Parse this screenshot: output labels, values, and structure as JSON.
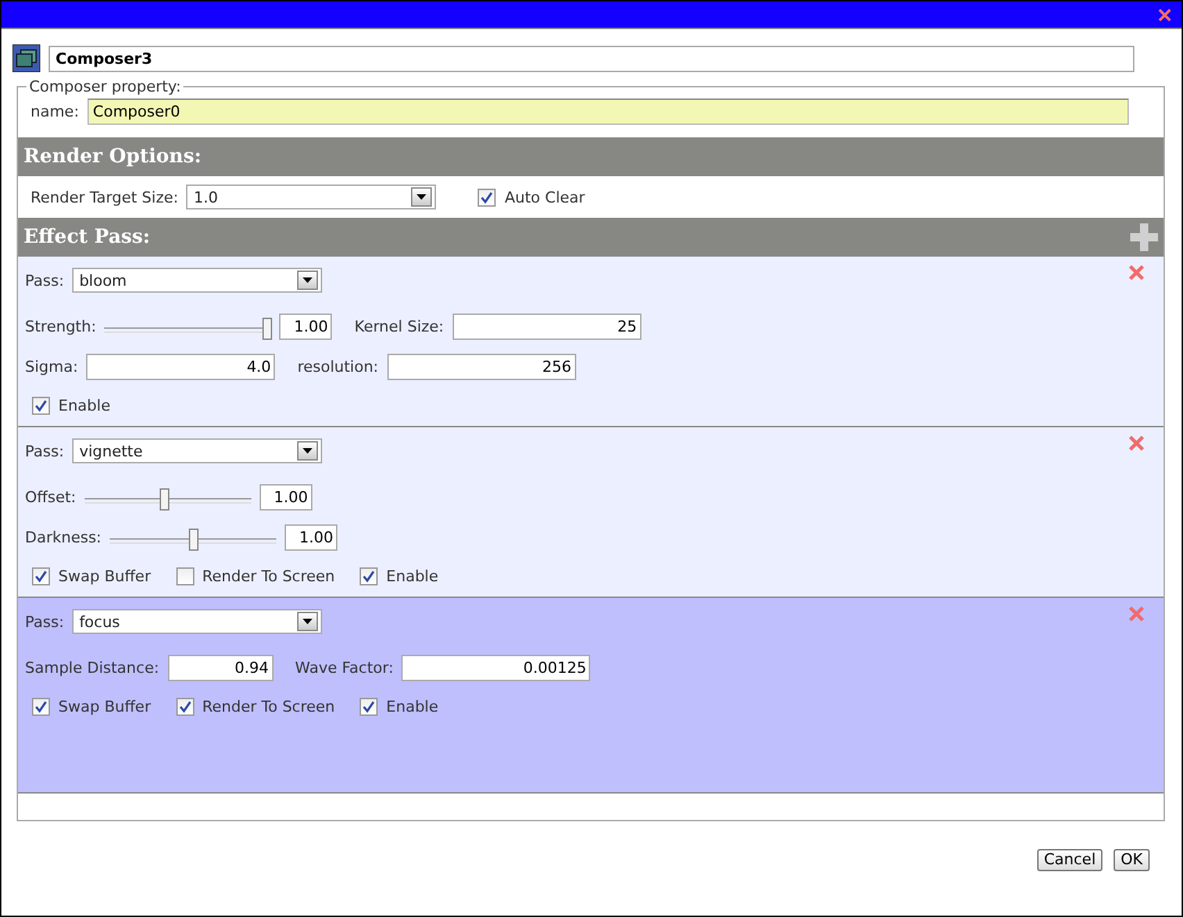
{
  "window": {
    "close": "✕"
  },
  "object_name": "Composer3",
  "property_group": {
    "legend": "Composer property:",
    "name_label": "name:",
    "name_value": "Composer0"
  },
  "render_options": {
    "title": "Render Options:",
    "size_label": "Render Target Size:",
    "size_value": "1.0",
    "auto_clear": {
      "label": "Auto Clear",
      "checked": true
    }
  },
  "effect_pass": {
    "title": "Effect Pass:",
    "passes": [
      {
        "selected": false,
        "pass_label": "Pass:",
        "pass_value": "bloom",
        "rows": [
          [
            {
              "kind": "slider",
              "label": "Strength:",
              "level": 0.97,
              "value": "1.00"
            },
            {
              "kind": "number",
              "label": "Kernel Size:",
              "value": "25"
            }
          ],
          [
            {
              "kind": "number",
              "label": "Sigma:",
              "value": "4.0"
            },
            {
              "kind": "number",
              "label": "resolution:",
              "value": "256"
            }
          ]
        ],
        "checks": [
          {
            "label": "Enable",
            "checked": true
          }
        ]
      },
      {
        "selected": false,
        "pass_label": "Pass:",
        "pass_value": "vignette",
        "rows": [
          [
            {
              "kind": "slider",
              "label": "Offset:",
              "level": 0.48,
              "value": "1.00"
            }
          ],
          [
            {
              "kind": "slider",
              "label": "Darkness:",
              "level": 0.5,
              "value": "1.00"
            }
          ]
        ],
        "checks": [
          {
            "label": "Swap Buffer",
            "checked": true
          },
          {
            "label": "Render To Screen",
            "checked": false
          },
          {
            "label": "Enable",
            "checked": true
          }
        ]
      },
      {
        "selected": true,
        "pass_label": "Pass:",
        "pass_value": "focus",
        "rows": [
          [
            {
              "kind": "number",
              "label": "Sample Distance:",
              "value": "0.94"
            },
            {
              "kind": "number",
              "label": "Wave Factor:",
              "value": "0.00125"
            }
          ]
        ],
        "checks": [
          {
            "label": "Swap Buffer",
            "checked": true
          },
          {
            "label": "Render To Screen",
            "checked": true
          },
          {
            "label": "Enable",
            "checked": true
          }
        ]
      }
    ]
  },
  "buttons": [
    "Cancel",
    "OK"
  ]
}
